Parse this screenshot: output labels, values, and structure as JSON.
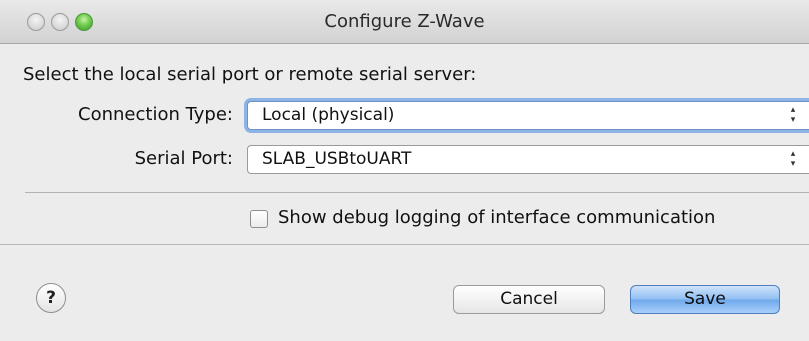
{
  "window": {
    "title": "Configure Z-Wave"
  },
  "form": {
    "instruction": "Select the local serial port or remote serial server:",
    "connection_type": {
      "label": "Connection Type:",
      "value": "Local (physical)"
    },
    "serial_port": {
      "label": "Serial Port:",
      "value": "SLAB_USBtoUART"
    },
    "debug_logging": {
      "label": "Show debug logging of interface communication",
      "checked": false
    }
  },
  "buttons": {
    "help": "?",
    "cancel": "Cancel",
    "save": "Save"
  },
  "icons": {
    "stepper": "▴▾"
  }
}
